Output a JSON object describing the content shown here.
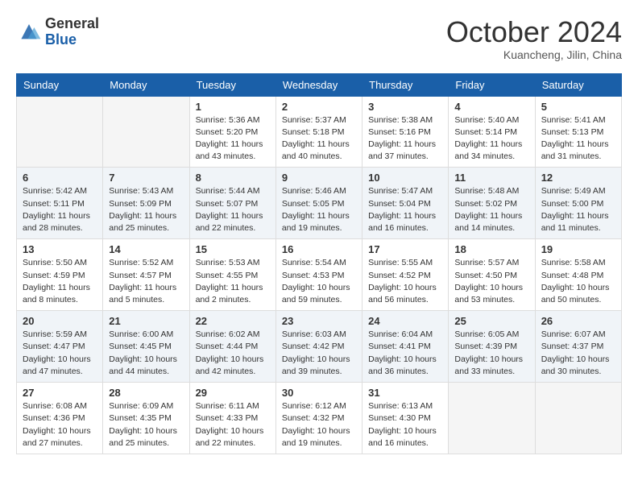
{
  "header": {
    "logo_general": "General",
    "logo_blue": "Blue",
    "month_title": "October 2024",
    "location": "Kuancheng, Jilin, China"
  },
  "weekdays": [
    "Sunday",
    "Monday",
    "Tuesday",
    "Wednesday",
    "Thursday",
    "Friday",
    "Saturday"
  ],
  "weeks": [
    [
      {
        "day": "",
        "sunrise": "",
        "sunset": "",
        "daylight": ""
      },
      {
        "day": "",
        "sunrise": "",
        "sunset": "",
        "daylight": ""
      },
      {
        "day": "1",
        "sunrise": "Sunrise: 5:36 AM",
        "sunset": "Sunset: 5:20 PM",
        "daylight": "Daylight: 11 hours and 43 minutes."
      },
      {
        "day": "2",
        "sunrise": "Sunrise: 5:37 AM",
        "sunset": "Sunset: 5:18 PM",
        "daylight": "Daylight: 11 hours and 40 minutes."
      },
      {
        "day": "3",
        "sunrise": "Sunrise: 5:38 AM",
        "sunset": "Sunset: 5:16 PM",
        "daylight": "Daylight: 11 hours and 37 minutes."
      },
      {
        "day": "4",
        "sunrise": "Sunrise: 5:40 AM",
        "sunset": "Sunset: 5:14 PM",
        "daylight": "Daylight: 11 hours and 34 minutes."
      },
      {
        "day": "5",
        "sunrise": "Sunrise: 5:41 AM",
        "sunset": "Sunset: 5:13 PM",
        "daylight": "Daylight: 11 hours and 31 minutes."
      }
    ],
    [
      {
        "day": "6",
        "sunrise": "Sunrise: 5:42 AM",
        "sunset": "Sunset: 5:11 PM",
        "daylight": "Daylight: 11 hours and 28 minutes."
      },
      {
        "day": "7",
        "sunrise": "Sunrise: 5:43 AM",
        "sunset": "Sunset: 5:09 PM",
        "daylight": "Daylight: 11 hours and 25 minutes."
      },
      {
        "day": "8",
        "sunrise": "Sunrise: 5:44 AM",
        "sunset": "Sunset: 5:07 PM",
        "daylight": "Daylight: 11 hours and 22 minutes."
      },
      {
        "day": "9",
        "sunrise": "Sunrise: 5:46 AM",
        "sunset": "Sunset: 5:05 PM",
        "daylight": "Daylight: 11 hours and 19 minutes."
      },
      {
        "day": "10",
        "sunrise": "Sunrise: 5:47 AM",
        "sunset": "Sunset: 5:04 PM",
        "daylight": "Daylight: 11 hours and 16 minutes."
      },
      {
        "day": "11",
        "sunrise": "Sunrise: 5:48 AM",
        "sunset": "Sunset: 5:02 PM",
        "daylight": "Daylight: 11 hours and 14 minutes."
      },
      {
        "day": "12",
        "sunrise": "Sunrise: 5:49 AM",
        "sunset": "Sunset: 5:00 PM",
        "daylight": "Daylight: 11 hours and 11 minutes."
      }
    ],
    [
      {
        "day": "13",
        "sunrise": "Sunrise: 5:50 AM",
        "sunset": "Sunset: 4:59 PM",
        "daylight": "Daylight: 11 hours and 8 minutes."
      },
      {
        "day": "14",
        "sunrise": "Sunrise: 5:52 AM",
        "sunset": "Sunset: 4:57 PM",
        "daylight": "Daylight: 11 hours and 5 minutes."
      },
      {
        "day": "15",
        "sunrise": "Sunrise: 5:53 AM",
        "sunset": "Sunset: 4:55 PM",
        "daylight": "Daylight: 11 hours and 2 minutes."
      },
      {
        "day": "16",
        "sunrise": "Sunrise: 5:54 AM",
        "sunset": "Sunset: 4:53 PM",
        "daylight": "Daylight: 10 hours and 59 minutes."
      },
      {
        "day": "17",
        "sunrise": "Sunrise: 5:55 AM",
        "sunset": "Sunset: 4:52 PM",
        "daylight": "Daylight: 10 hours and 56 minutes."
      },
      {
        "day": "18",
        "sunrise": "Sunrise: 5:57 AM",
        "sunset": "Sunset: 4:50 PM",
        "daylight": "Daylight: 10 hours and 53 minutes."
      },
      {
        "day": "19",
        "sunrise": "Sunrise: 5:58 AM",
        "sunset": "Sunset: 4:48 PM",
        "daylight": "Daylight: 10 hours and 50 minutes."
      }
    ],
    [
      {
        "day": "20",
        "sunrise": "Sunrise: 5:59 AM",
        "sunset": "Sunset: 4:47 PM",
        "daylight": "Daylight: 10 hours and 47 minutes."
      },
      {
        "day": "21",
        "sunrise": "Sunrise: 6:00 AM",
        "sunset": "Sunset: 4:45 PM",
        "daylight": "Daylight: 10 hours and 44 minutes."
      },
      {
        "day": "22",
        "sunrise": "Sunrise: 6:02 AM",
        "sunset": "Sunset: 4:44 PM",
        "daylight": "Daylight: 10 hours and 42 minutes."
      },
      {
        "day": "23",
        "sunrise": "Sunrise: 6:03 AM",
        "sunset": "Sunset: 4:42 PM",
        "daylight": "Daylight: 10 hours and 39 minutes."
      },
      {
        "day": "24",
        "sunrise": "Sunrise: 6:04 AM",
        "sunset": "Sunset: 4:41 PM",
        "daylight": "Daylight: 10 hours and 36 minutes."
      },
      {
        "day": "25",
        "sunrise": "Sunrise: 6:05 AM",
        "sunset": "Sunset: 4:39 PM",
        "daylight": "Daylight: 10 hours and 33 minutes."
      },
      {
        "day": "26",
        "sunrise": "Sunrise: 6:07 AM",
        "sunset": "Sunset: 4:37 PM",
        "daylight": "Daylight: 10 hours and 30 minutes."
      }
    ],
    [
      {
        "day": "27",
        "sunrise": "Sunrise: 6:08 AM",
        "sunset": "Sunset: 4:36 PM",
        "daylight": "Daylight: 10 hours and 27 minutes."
      },
      {
        "day": "28",
        "sunrise": "Sunrise: 6:09 AM",
        "sunset": "Sunset: 4:35 PM",
        "daylight": "Daylight: 10 hours and 25 minutes."
      },
      {
        "day": "29",
        "sunrise": "Sunrise: 6:11 AM",
        "sunset": "Sunset: 4:33 PM",
        "daylight": "Daylight: 10 hours and 22 minutes."
      },
      {
        "day": "30",
        "sunrise": "Sunrise: 6:12 AM",
        "sunset": "Sunset: 4:32 PM",
        "daylight": "Daylight: 10 hours and 19 minutes."
      },
      {
        "day": "31",
        "sunrise": "Sunrise: 6:13 AM",
        "sunset": "Sunset: 4:30 PM",
        "daylight": "Daylight: 10 hours and 16 minutes."
      },
      {
        "day": "",
        "sunrise": "",
        "sunset": "",
        "daylight": ""
      },
      {
        "day": "",
        "sunrise": "",
        "sunset": "",
        "daylight": ""
      }
    ]
  ]
}
